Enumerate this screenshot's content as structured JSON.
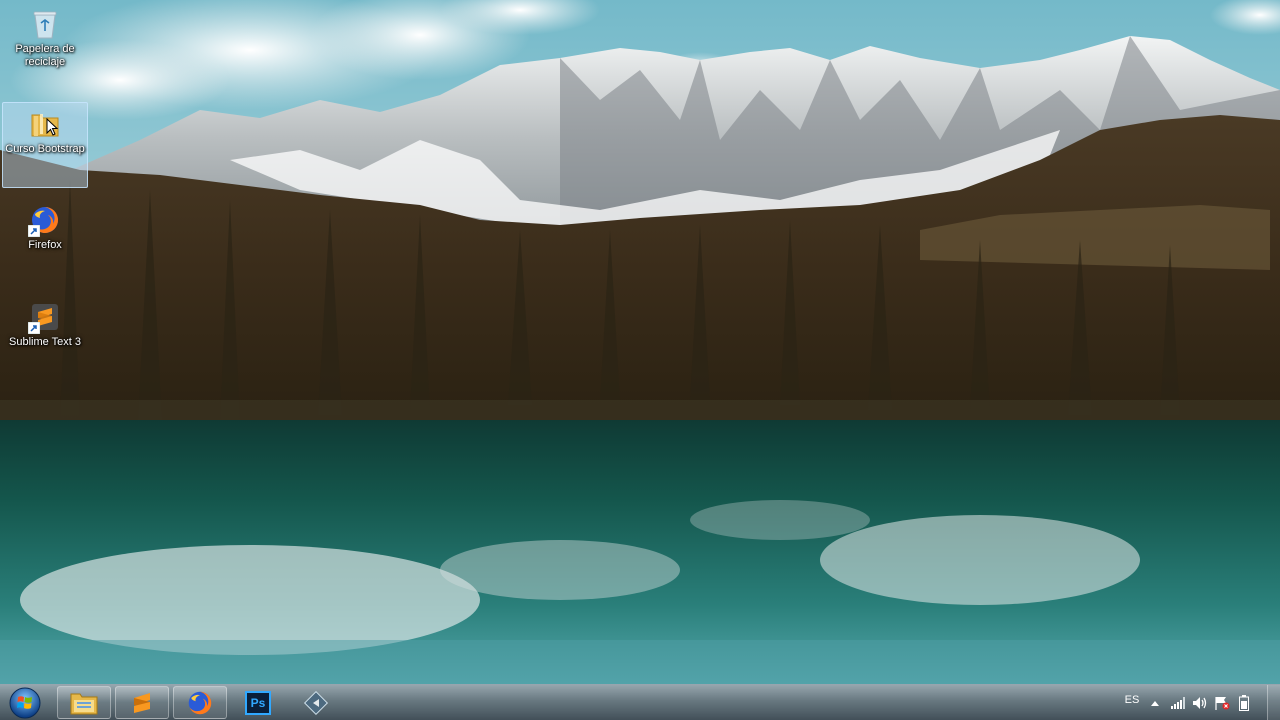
{
  "desktop": {
    "icons": [
      {
        "label": "Papelera de reciclaje",
        "icon": "recycle-bin-icon"
      },
      {
        "label": "Curso Bootstrap",
        "icon": "folder-icon",
        "selected": true
      },
      {
        "label": "Firefox",
        "icon": "firefox-icon"
      },
      {
        "label": "Sublime Text 3",
        "icon": "sublime-text-icon"
      }
    ]
  },
  "taskbar": {
    "start_icon": "windows-start-orb-icon",
    "pinned": [
      {
        "name": "windows-explorer",
        "icon": "folder-icon"
      },
      {
        "name": "sublime-text",
        "icon": "sublime-text-icon"
      },
      {
        "name": "firefox",
        "icon": "firefox-icon"
      },
      {
        "name": "photoshop",
        "icon": "photoshop-icon",
        "text": "Ps"
      },
      {
        "name": "app",
        "icon": "app-diamond-icon"
      }
    ],
    "tray": {
      "language": "ES",
      "icons": [
        "show-hidden-icons-arrow-icon",
        "network-signal-icon",
        "volume-icon",
        "action-center-flag-icon",
        "battery-icon"
      ]
    }
  },
  "colors": {
    "taskbar": "#3f5560",
    "photoshop_bg": "#0a1f3a",
    "photoshop_text": "#31a8ff",
    "sublime": "#f89820",
    "firefox": "#ff7a1a"
  }
}
